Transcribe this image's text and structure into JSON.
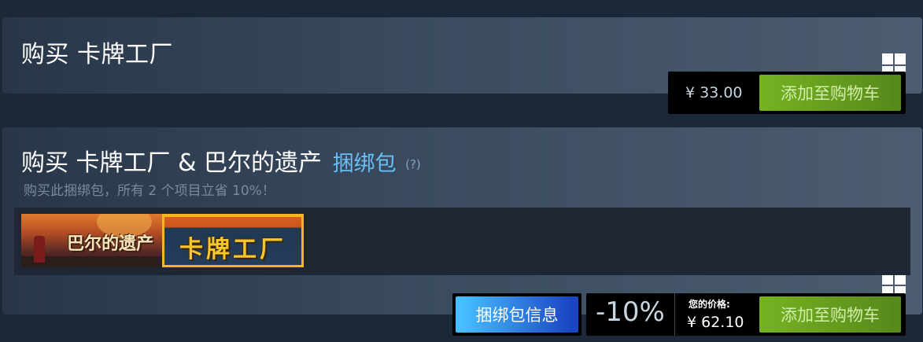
{
  "purchase1": {
    "title": "购买 卡牌工厂",
    "price": "¥ 33.00",
    "cart_label": "添加至购物车",
    "platform_icon": "windows-icon"
  },
  "purchase2": {
    "title": "购买 卡牌工厂 & 巴尔的遗产",
    "bundle_tag": "捆绑包",
    "help": "(?)",
    "subtitle": "购买此捆绑包，所有 2 个项目立省 10%！",
    "platform_icon": "windows-icon",
    "capsules": [
      {
        "title": "巴尔的遗产"
      },
      {
        "title": "卡牌工厂"
      }
    ],
    "bundle_info_label": "捆绑包信息",
    "discount": "-10%",
    "your_price_label": "您的价格:",
    "final_price": "¥ 62.10",
    "cart_label": "添加至购物车"
  },
  "colors": {
    "background": "#1b2838",
    "cart_green": "#75b022",
    "bundle_blue": "#47bfff",
    "bundle_tag": "#67c1f5"
  }
}
